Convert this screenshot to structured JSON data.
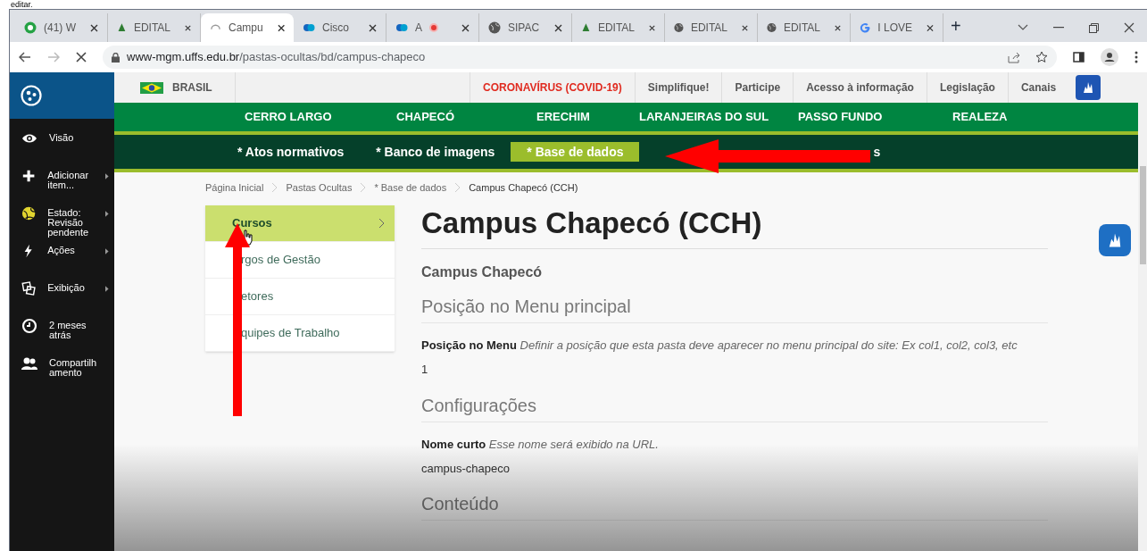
{
  "document_text": "editar.",
  "browser": {
    "tabs": [
      {
        "title": "(41) W",
        "kind": "chat",
        "selected": false
      },
      {
        "title": "EDITAL",
        "kind": "tree",
        "selected": false
      },
      {
        "title": "Campu",
        "kind": "loading",
        "selected": true
      },
      {
        "title": "Cisco",
        "kind": "meeting",
        "selected": false
      },
      {
        "title": "A",
        "kind": "recording",
        "selected": false
      },
      {
        "title": "SIPAC",
        "kind": "globe",
        "selected": false
      },
      {
        "title": "EDITAL",
        "kind": "tree",
        "selected": false
      },
      {
        "title": "EDITAL",
        "kind": "globe",
        "selected": false
      },
      {
        "title": "EDITAL",
        "kind": "globe",
        "selected": false
      },
      {
        "title": "I LOVE",
        "kind": "google",
        "selected": false
      }
    ],
    "new_tab": "+",
    "address": {
      "host": "www-mgm.uffs.edu.br",
      "path": "/pastas-ocultas/bd/campus-chapeco"
    }
  },
  "toolbar": {
    "items": [
      {
        "label": "Visão",
        "kind": "eye",
        "has_submenu": false
      },
      {
        "label": "Adicionar item...",
        "kind": "plus",
        "has_submenu": true
      },
      {
        "label": "Estado: Revisão pendente",
        "kind": "state",
        "has_submenu": true
      },
      {
        "label": "Ações",
        "kind": "bolt",
        "has_submenu": true
      },
      {
        "label": "Exibição",
        "kind": "display",
        "has_submenu": true
      },
      {
        "label": "2 meses atrás",
        "kind": "clock",
        "has_submenu": false
      },
      {
        "label": "Compartilhamento",
        "kind": "users",
        "has_submenu": false
      }
    ]
  },
  "gov_bar": {
    "country": "BRASIL",
    "links": [
      {
        "label": "CORONAVÍRUS (COVID-19)",
        "alert": true
      },
      {
        "label": "Simplifique!",
        "alert": false
      },
      {
        "label": "Participe",
        "alert": false
      },
      {
        "label": "Acesso à informação",
        "alert": false
      },
      {
        "label": "Legislação",
        "alert": false
      },
      {
        "label": "Canais",
        "alert": false
      }
    ]
  },
  "campus_menu": [
    "CERRO LARGO",
    "CHAPECÓ",
    "ERECHIM",
    "LARANJEIRAS DO SUL",
    "PASSO FUNDO",
    "REALEZA"
  ],
  "section_menu": [
    {
      "label": "* Atos normativos",
      "selected": false
    },
    {
      "label": "* Banco de imagens",
      "selected": false
    },
    {
      "label": "* Base de dados",
      "selected": true
    },
    {
      "label": "s",
      "selected": false
    }
  ],
  "breadcrumb": [
    "Página Inicial",
    "Pastas Ocultas",
    "* Base de dados",
    "Campus Chapecó (CCH)"
  ],
  "side_nav": [
    {
      "label": "Cursos",
      "selected": true
    },
    {
      "label": "rgos de Gestão",
      "selected": false
    },
    {
      "label": "etores",
      "selected": false
    },
    {
      "label": "quipes de Trabalho",
      "selected": false
    }
  ],
  "content": {
    "title": "Campus Chapecó (CCH)",
    "subtitle": "Campus Chapecó",
    "blocks": [
      {
        "kind": "section",
        "text": "Posição no Menu principal"
      },
      {
        "kind": "field",
        "text": "**Posição no Menu** *Definir a posição que esta pasta deve aparecer no menu principal do site: Ex col1, col2, col3, etc*"
      },
      {
        "kind": "value",
        "text": "1"
      },
      {
        "kind": "section",
        "text": "Configurações"
      },
      {
        "kind": "field",
        "text": "**Nome curto** *Esse nome será exibido na URL.*"
      },
      {
        "kind": "value",
        "text": "campus-chapeco"
      },
      {
        "kind": "section",
        "text": "Conteúdo"
      }
    ]
  }
}
